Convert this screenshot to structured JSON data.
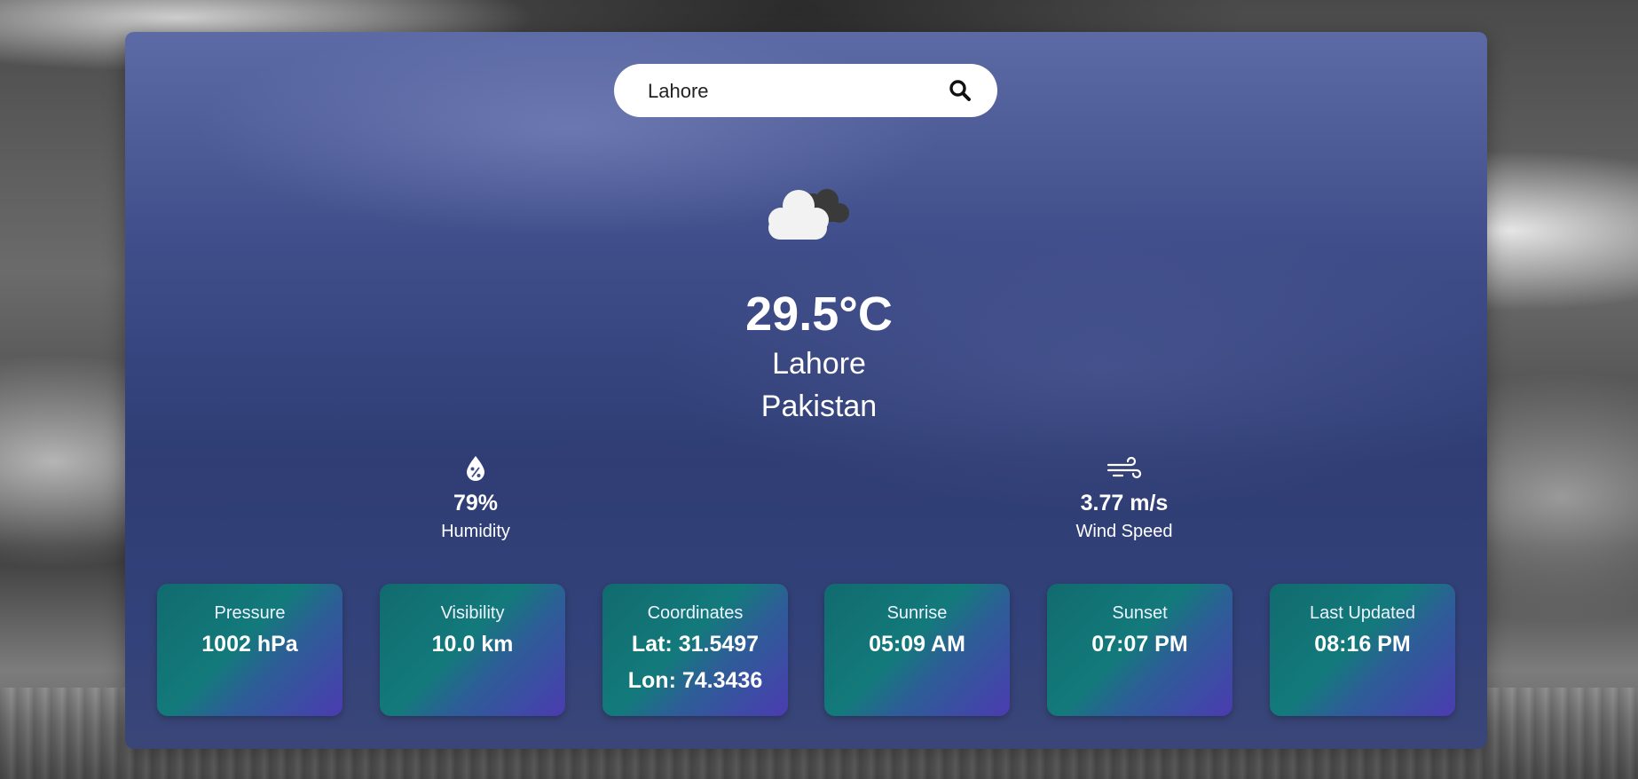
{
  "search": {
    "value": "Lahore",
    "icon": "search-icon"
  },
  "weather": {
    "icon": "cloudy-icon",
    "temperature": "29.5°C",
    "city": "Lahore",
    "country": "Pakistan"
  },
  "stats": {
    "humidity": {
      "icon": "humidity-drop-icon",
      "value": "79%",
      "label": "Humidity"
    },
    "wind": {
      "icon": "wind-icon",
      "value": "3.77 m/s",
      "label": "Wind Speed"
    }
  },
  "cards": {
    "pressure": {
      "title": "Pressure",
      "value": "1002 hPa"
    },
    "visibility": {
      "title": "Visibility",
      "value": "10.0 km"
    },
    "coordinates": {
      "title": "Coordinates",
      "lat": "Lat: 31.5497",
      "lon": "Lon: 74.3436"
    },
    "sunrise": {
      "title": "Sunrise",
      "value": "05:09 AM"
    },
    "sunset": {
      "title": "Sunset",
      "value": "07:07 PM"
    },
    "last_updated": {
      "title": "Last Updated",
      "value": "08:16 PM"
    }
  },
  "colors": {
    "panel": "#3f4d8a",
    "card_start": "#116b6e",
    "card_end": "#4b3bb0",
    "text": "#ffffff"
  }
}
